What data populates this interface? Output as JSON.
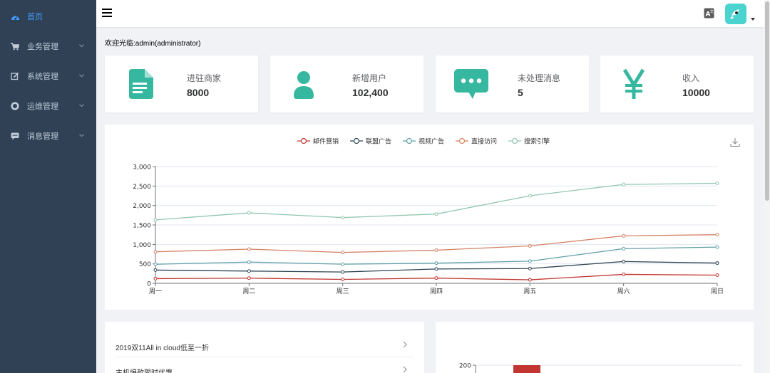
{
  "sidebar": {
    "items": [
      {
        "label": "首页",
        "icon": "dashboard-icon",
        "active": true,
        "has_children": false
      },
      {
        "label": "业务管理",
        "icon": "shopping-cart-icon",
        "active": false,
        "has_children": true
      },
      {
        "label": "系统管理",
        "icon": "edit-icon",
        "active": false,
        "has_children": true
      },
      {
        "label": "运维管理",
        "icon": "lifebuoy-icon",
        "active": false,
        "has_children": true
      },
      {
        "label": "消息管理",
        "icon": "chat-icon",
        "active": false,
        "has_children": true
      }
    ]
  },
  "header": {
    "menu_icon": "hamburger-icon",
    "lang_icon": "translate-icon"
  },
  "welcome_text": "欢迎光临:admin(administrator)",
  "cards": [
    {
      "title": "进驻商家",
      "value": "8000",
      "icon": "document-icon"
    },
    {
      "title": "新增用户",
      "value": "102,400",
      "icon": "user-icon"
    },
    {
      "title": "未处理消息",
      "value": "5",
      "icon": "message-icon"
    },
    {
      "title": "收入",
      "value": "10000",
      "icon": "yen-icon"
    }
  ],
  "colors": {
    "accent": "#409eff",
    "card_icon": "#36b8a0",
    "sidebar_bg": "#304156"
  },
  "chart_data": [
    {
      "type": "line",
      "categories": [
        "周一",
        "周二",
        "周三",
        "周四",
        "周五",
        "周六",
        "周日"
      ],
      "ylim": [
        0,
        3000
      ],
      "yticks": [
        0,
        500,
        1000,
        1500,
        2000,
        2500,
        3000
      ],
      "ytick_labels": [
        "0",
        "500",
        "1,000",
        "1,500",
        "2,000",
        "2,500",
        "3,000"
      ],
      "grid": true,
      "legend_position": "top-center",
      "series": [
        {
          "name": "邮件营销",
          "color": "#c23531",
          "values": [
            120,
            132,
            101,
            134,
            90,
            230,
            210
          ]
        },
        {
          "name": "联盟广告",
          "color": "#2f4554",
          "values": [
            340,
            314,
            291,
            368,
            380,
            560,
            520
          ]
        },
        {
          "name": "视频广告",
          "color": "#61a0a8",
          "values": [
            490,
            546,
            492,
            518,
            570,
            890,
            930
          ]
        },
        {
          "name": "直接访问",
          "color": "#d48265",
          "values": [
            810,
            878,
            793,
            852,
            960,
            1220,
            1250
          ]
        },
        {
          "name": "搜索引擎",
          "color": "#91c7ae",
          "values": [
            1630,
            1810,
            1690,
            1780,
            2250,
            2540,
            2570
          ]
        }
      ]
    },
    {
      "type": "bar",
      "ytick_labels": [
        "200"
      ],
      "series": [
        {
          "color": "#c23531",
          "values": [
            200
          ]
        }
      ]
    }
  ],
  "news_list": [
    {
      "text": "2019双11All in cloud低至一折"
    },
    {
      "text": "主机爆款限时优惠"
    }
  ]
}
